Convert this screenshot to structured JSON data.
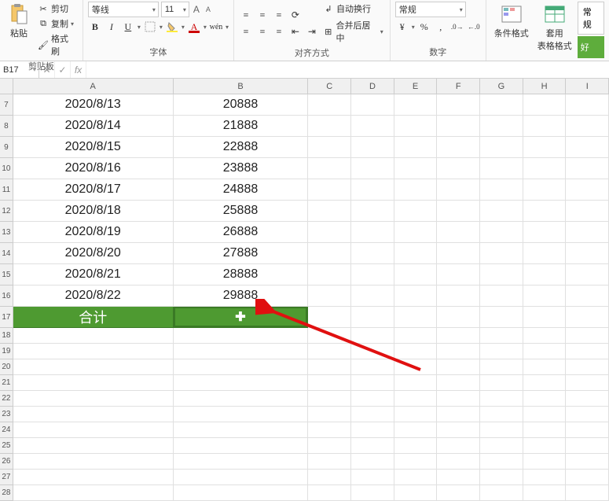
{
  "ribbon": {
    "clipboard": {
      "paste": "粘贴",
      "cut": "剪切",
      "copy": "复制",
      "format_painter": "格式刷",
      "group": "剪贴板"
    },
    "font": {
      "font_name": "等线",
      "font_size": "11",
      "bold": "B",
      "italic": "I",
      "underline": "U",
      "inc_a": "A",
      "dec_a": "A",
      "group": "字体"
    },
    "align": {
      "wrap": "自动换行",
      "merge": "合并后居中",
      "group": "对齐方式"
    },
    "number": {
      "format": "常规",
      "group": "数字"
    },
    "styles": {
      "cond_fmt": "条件格式",
      "table_fmt": "套用\n表格格式",
      "good": "好",
      "normal": "常规"
    }
  },
  "formula_bar": {
    "name_box": "B17",
    "fx": "fx"
  },
  "columns": [
    "A",
    "B",
    "C",
    "D",
    "E",
    "F",
    "G",
    "H",
    "I"
  ],
  "rows": [
    {
      "n": "7",
      "a": "2020/8/13",
      "b": "20888"
    },
    {
      "n": "8",
      "a": "2020/8/14",
      "b": "21888"
    },
    {
      "n": "9",
      "a": "2020/8/15",
      "b": "22888"
    },
    {
      "n": "10",
      "a": "2020/8/16",
      "b": "23888"
    },
    {
      "n": "11",
      "a": "2020/8/17",
      "b": "24888"
    },
    {
      "n": "12",
      "a": "2020/8/18",
      "b": "25888"
    },
    {
      "n": "13",
      "a": "2020/8/19",
      "b": "26888"
    },
    {
      "n": "14",
      "a": "2020/8/20",
      "b": "27888"
    },
    {
      "n": "15",
      "a": "2020/8/21",
      "b": "28888"
    },
    {
      "n": "16",
      "a": "2020/8/22",
      "b": "29888"
    }
  ],
  "total_row": {
    "n": "17",
    "a": "合计",
    "b_cursor": "✚"
  },
  "empty_rows": [
    "18",
    "19",
    "20",
    "21",
    "22",
    "23",
    "24",
    "25",
    "26",
    "27",
    "28"
  ]
}
